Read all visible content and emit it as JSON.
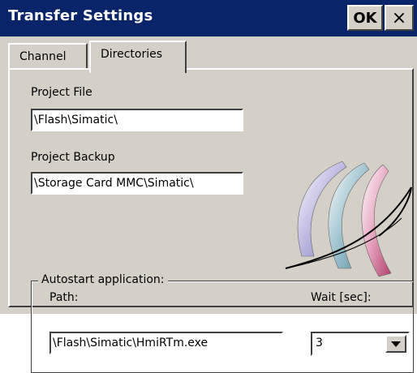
{
  "window": {
    "title": "Transfer Settings",
    "ok_label": "OK",
    "close_label": "×"
  },
  "tabs": [
    {
      "label": "Channel",
      "active": false
    },
    {
      "label": "Directories",
      "active": true
    }
  ],
  "directories": {
    "project_file": {
      "label": "Project File",
      "value": "\\Flash\\Simatic\\"
    },
    "project_backup": {
      "label": "Project Backup",
      "value": "\\Storage Card MMC\\Simatic\\"
    },
    "autostart": {
      "legend": "Autostart application:",
      "path_label": "Path:",
      "path_value": "\\Flash\\Simatic\\HmiRTm.exe",
      "wait_label": "Wait [sec]:",
      "wait_value": "3"
    }
  },
  "colors": {
    "titlebar": "#0a246a",
    "dialog_bg": "#d4d0c8",
    "field_bg": "#ffffff"
  },
  "icons": {
    "logo": "simatic-arcs-logo",
    "dropdown": "chevron-down-icon"
  }
}
